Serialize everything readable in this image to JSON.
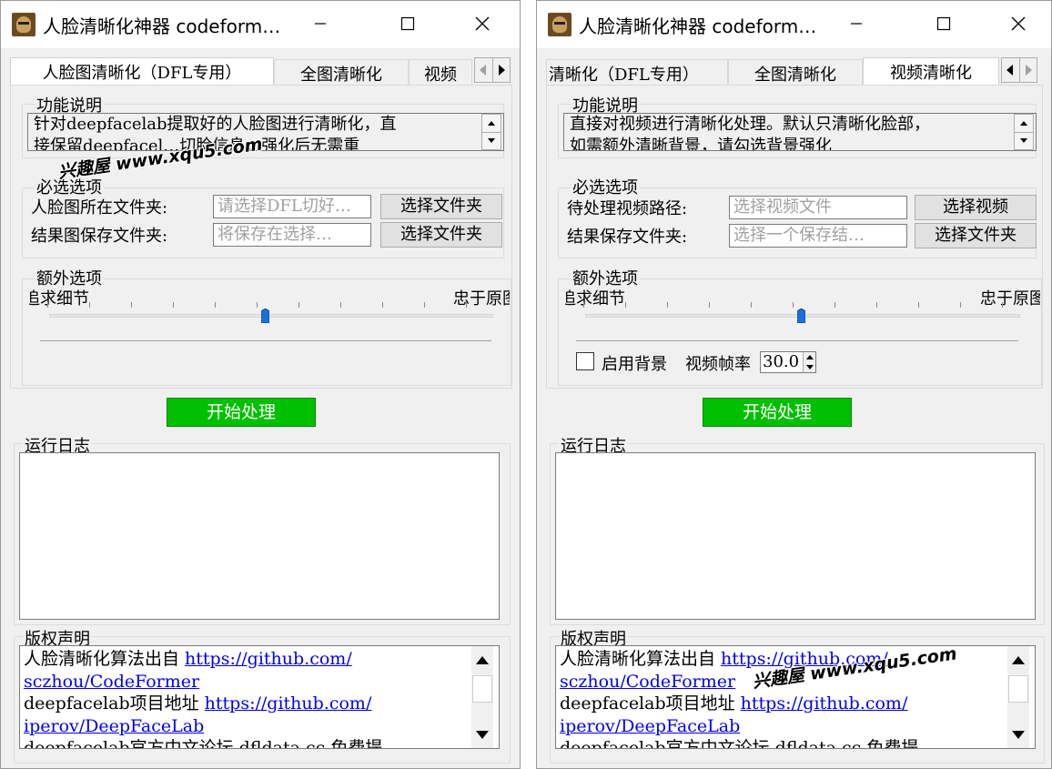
{
  "left_window": {
    "title": "人脸清晰化神器 codeform…",
    "tabs": [
      "人脸图清晰化（DFL专用）",
      "全图清晰化",
      "视频"
    ],
    "func_desc": {
      "group_label": "功能说明",
      "line1": "针对deepfacelab提取好的人脸图进行清晰化，直",
      "line2": "接保留deepfacel…切脸信息，强化后无需重"
    },
    "required": {
      "group_label": "必选选项",
      "row1_label": "人脸图所在文件夹:",
      "row1_placeholder": "请选择DFL切好…",
      "row1_button": "选择文件夹",
      "row2_label": "结果图保存文件夹:",
      "row2_placeholder": "将保存在选择…",
      "row2_button": "选择文件夹"
    },
    "extra": {
      "group_label": "额外选项",
      "slider_left": "追求细节",
      "slider_right": "忠于原图",
      "slider_value": 0.5
    },
    "start_button": "开始处理",
    "log_label": "运行日志",
    "copyright": {
      "label": "版权声明",
      "l1_text": "人脸清晰化算法出自 ",
      "l1_link": "https://github.com/",
      "l2_link": "sczhou/CodeFormer",
      "l3_text": "deepfacelab项目地址 ",
      "l3_link": "https://github.com/",
      "l4_link": "iperov/DeepFaceLab",
      "l5_text": "deepfacelab官方中文论坛  dfldata.cc  免费提"
    },
    "watermark": "兴趣屋 www.xqu5.com"
  },
  "right_window": {
    "title": "人脸清晰化神器 codeform…",
    "tabs": [
      "清晰化（DFL专用）",
      "全图清晰化",
      "视频清晰化"
    ],
    "func_desc": {
      "group_label": "功能说明",
      "line1": "直接对视频进行清晰化处理。默认只清晰化脸部，",
      "line2": "如需额外清晰背景，请勾选背景强化"
    },
    "required": {
      "group_label": "必选选项",
      "row1_label": "待处理视频路径:",
      "row1_placeholder": "选择视频文件",
      "row1_button": "选择视频",
      "row2_label": "结果保存文件夹:",
      "row2_placeholder": "选择一个保存结…",
      "row2_button": "选择文件夹"
    },
    "extra": {
      "group_label": "额外选项",
      "slider_left": "追求细节",
      "slider_right": "忠于原图",
      "slider_value": 0.5,
      "checkbox_label": "启用背景",
      "fps_label": "视频帧率",
      "fps_value": "30.0"
    },
    "start_button": "开始处理",
    "log_label": "运行日志",
    "copyright": {
      "label": "版权声明",
      "l1_text": "人脸清晰化算法出自 ",
      "l1_link": "https://github.com/",
      "l2_link": "sczhou/CodeFormer",
      "l3_text": "deepfacelab项目地址 ",
      "l3_link": "https://github.com/",
      "l4_link": "iperov/DeepFaceLab",
      "l5_text": "deepfacelab官方中文论坛  dfldata.cc  免费提"
    },
    "watermark": "兴趣屋 www.xqu5.com"
  }
}
